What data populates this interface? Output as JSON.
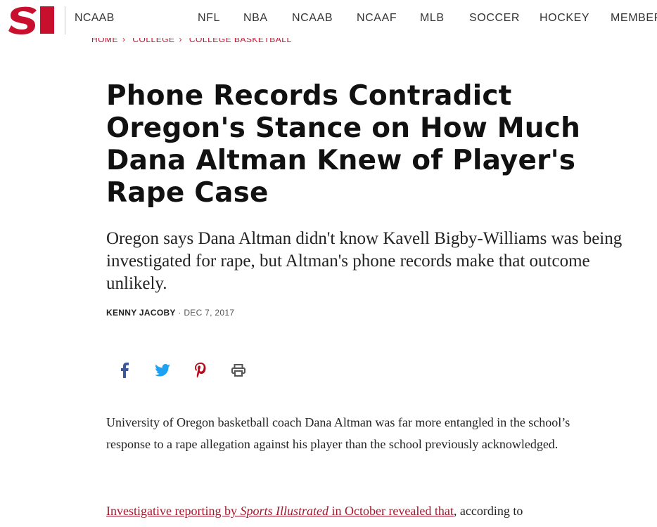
{
  "nav": {
    "section": "NCAAB",
    "items": [
      "NFL",
      "NBA",
      "NCAAB",
      "NCAAF",
      "MLB",
      "SOCCER",
      "HOCKEY",
      "MEMBER"
    ]
  },
  "breadcrumb": [
    "HOME",
    "COLLEGE",
    "COLLEGE BASKETBALL"
  ],
  "article": {
    "headline": "Phone Records Contradict Oregon's Stance on How Much Dana Altman Knew of Player's Rape Case",
    "dek": "Oregon says Dana Altman didn't know Kavell Bigby-Williams was being investigated for rape, but Altman's phone records make that outcome unlikely.",
    "author": "KENNY JACOBY",
    "separator": " · ",
    "date": "DEC 7, 2017",
    "paragraph1": "University of Oregon basketball coach Dana Altman was far more entangled in the school’s response to a rape allegation against his player than the school previously acknowledged.",
    "p2_link_pre": "Investigative reporting by ",
    "p2_link_italic": "Sports Illustrated",
    "p2_link_post": " in October revealed that",
    "p2_rest": ", according to"
  },
  "share": [
    "facebook-icon",
    "twitter-icon",
    "pinterest-icon",
    "print-icon"
  ],
  "colors": {
    "brand_red": "#c8102e",
    "facebook": "#3b5998",
    "twitter": "#1da1f2",
    "pinterest": "#bd081c",
    "print": "#555555",
    "link": "#a3172c"
  }
}
